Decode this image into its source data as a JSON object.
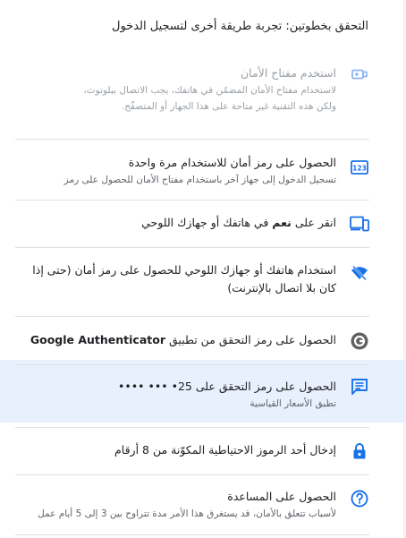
{
  "header": {
    "title": "التحقق بخطوتين: تجربة طريقة أخرى لتسجيل الدخول"
  },
  "options": [
    {
      "icon": "security-key-icon",
      "title": "استخدم مفتاح الأمان",
      "desc1": "لاستخدام مفتاح الأمان المضمّن في هاتفك، يجب الاتصال ببلوتوث،",
      "desc2": "ولكن هذه التقنية غير متاحة على هذا الجهاز أو المتصفّح."
    },
    {
      "icon": "numeric-123-icon",
      "title": "الحصول على رمز أمان للاستخدام مرة واحدة",
      "desc": "تسجيل الدخول إلى جهاز آخر باستخدام مفتاح الأمان للحصول على رمز"
    },
    {
      "icon": "devices-icon",
      "title_pre": "انقر على ",
      "title_bold": "نعم",
      "title_post": " في هاتفك أو جهازك اللوحي"
    },
    {
      "icon": "offline-phone-icon",
      "title_line1": "استخدام هاتفك أو جهازك اللوحي للحصول على رمز أمان (حتى إذا",
      "title_line2": "كان بلا اتصال بالإنترنت)"
    },
    {
      "icon": "google-authenticator-icon",
      "title_pre": "الحصول على رمز التحقق من تطبيق ",
      "title_bold": "Google Authenticator"
    },
    {
      "icon": "sms-message-icon",
      "title_pre": "الحصول على رمز التحقق على ",
      "phone": "•••• ••• •25",
      "desc": "تطبق الأسعار القياسية"
    },
    {
      "icon": "lock-icon",
      "title": "إدخال أحد الرموز الاحتياطية المكوّنة من 8 أرقام"
    },
    {
      "icon": "help-icon",
      "title": "الحصول على المساعدة",
      "desc": "لأسباب تتعلق بالأمان، قد يستغرق هذا الأمر مدة تتراوح بين 3 إلى 5 أيام عمل"
    }
  ],
  "colors": {
    "accent": "#1a73e8",
    "disabled": "#9aa0a6",
    "highlight": "#e8f0fe",
    "divider": "#e0e0e0"
  }
}
